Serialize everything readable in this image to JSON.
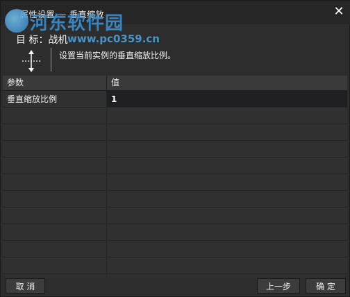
{
  "window": {
    "title": "属性设置 — 垂直缩放",
    "close_symbol": "✕"
  },
  "watermark": {
    "brand": "河东软件园",
    "url": "www.pc0359.cn"
  },
  "target": {
    "label": "目 标：战机"
  },
  "description": {
    "icon": "vertical-scale-icon",
    "text": "设置当前实例的垂直缩放比例。"
  },
  "grid": {
    "headers": [
      "参数",
      "值"
    ],
    "rows": [
      {
        "param": "垂直缩放比例",
        "value": "1"
      },
      {
        "param": "",
        "value": ""
      },
      {
        "param": "",
        "value": ""
      },
      {
        "param": "",
        "value": ""
      },
      {
        "param": "",
        "value": ""
      },
      {
        "param": "",
        "value": ""
      },
      {
        "param": "",
        "value": ""
      },
      {
        "param": "",
        "value": ""
      },
      {
        "param": "",
        "value": ""
      },
      {
        "param": "",
        "value": ""
      },
      {
        "param": "",
        "value": ""
      },
      {
        "param": "",
        "value": ""
      }
    ]
  },
  "buttons": {
    "cancel": "取 消",
    "prev": "上一步",
    "ok": "确 定"
  }
}
